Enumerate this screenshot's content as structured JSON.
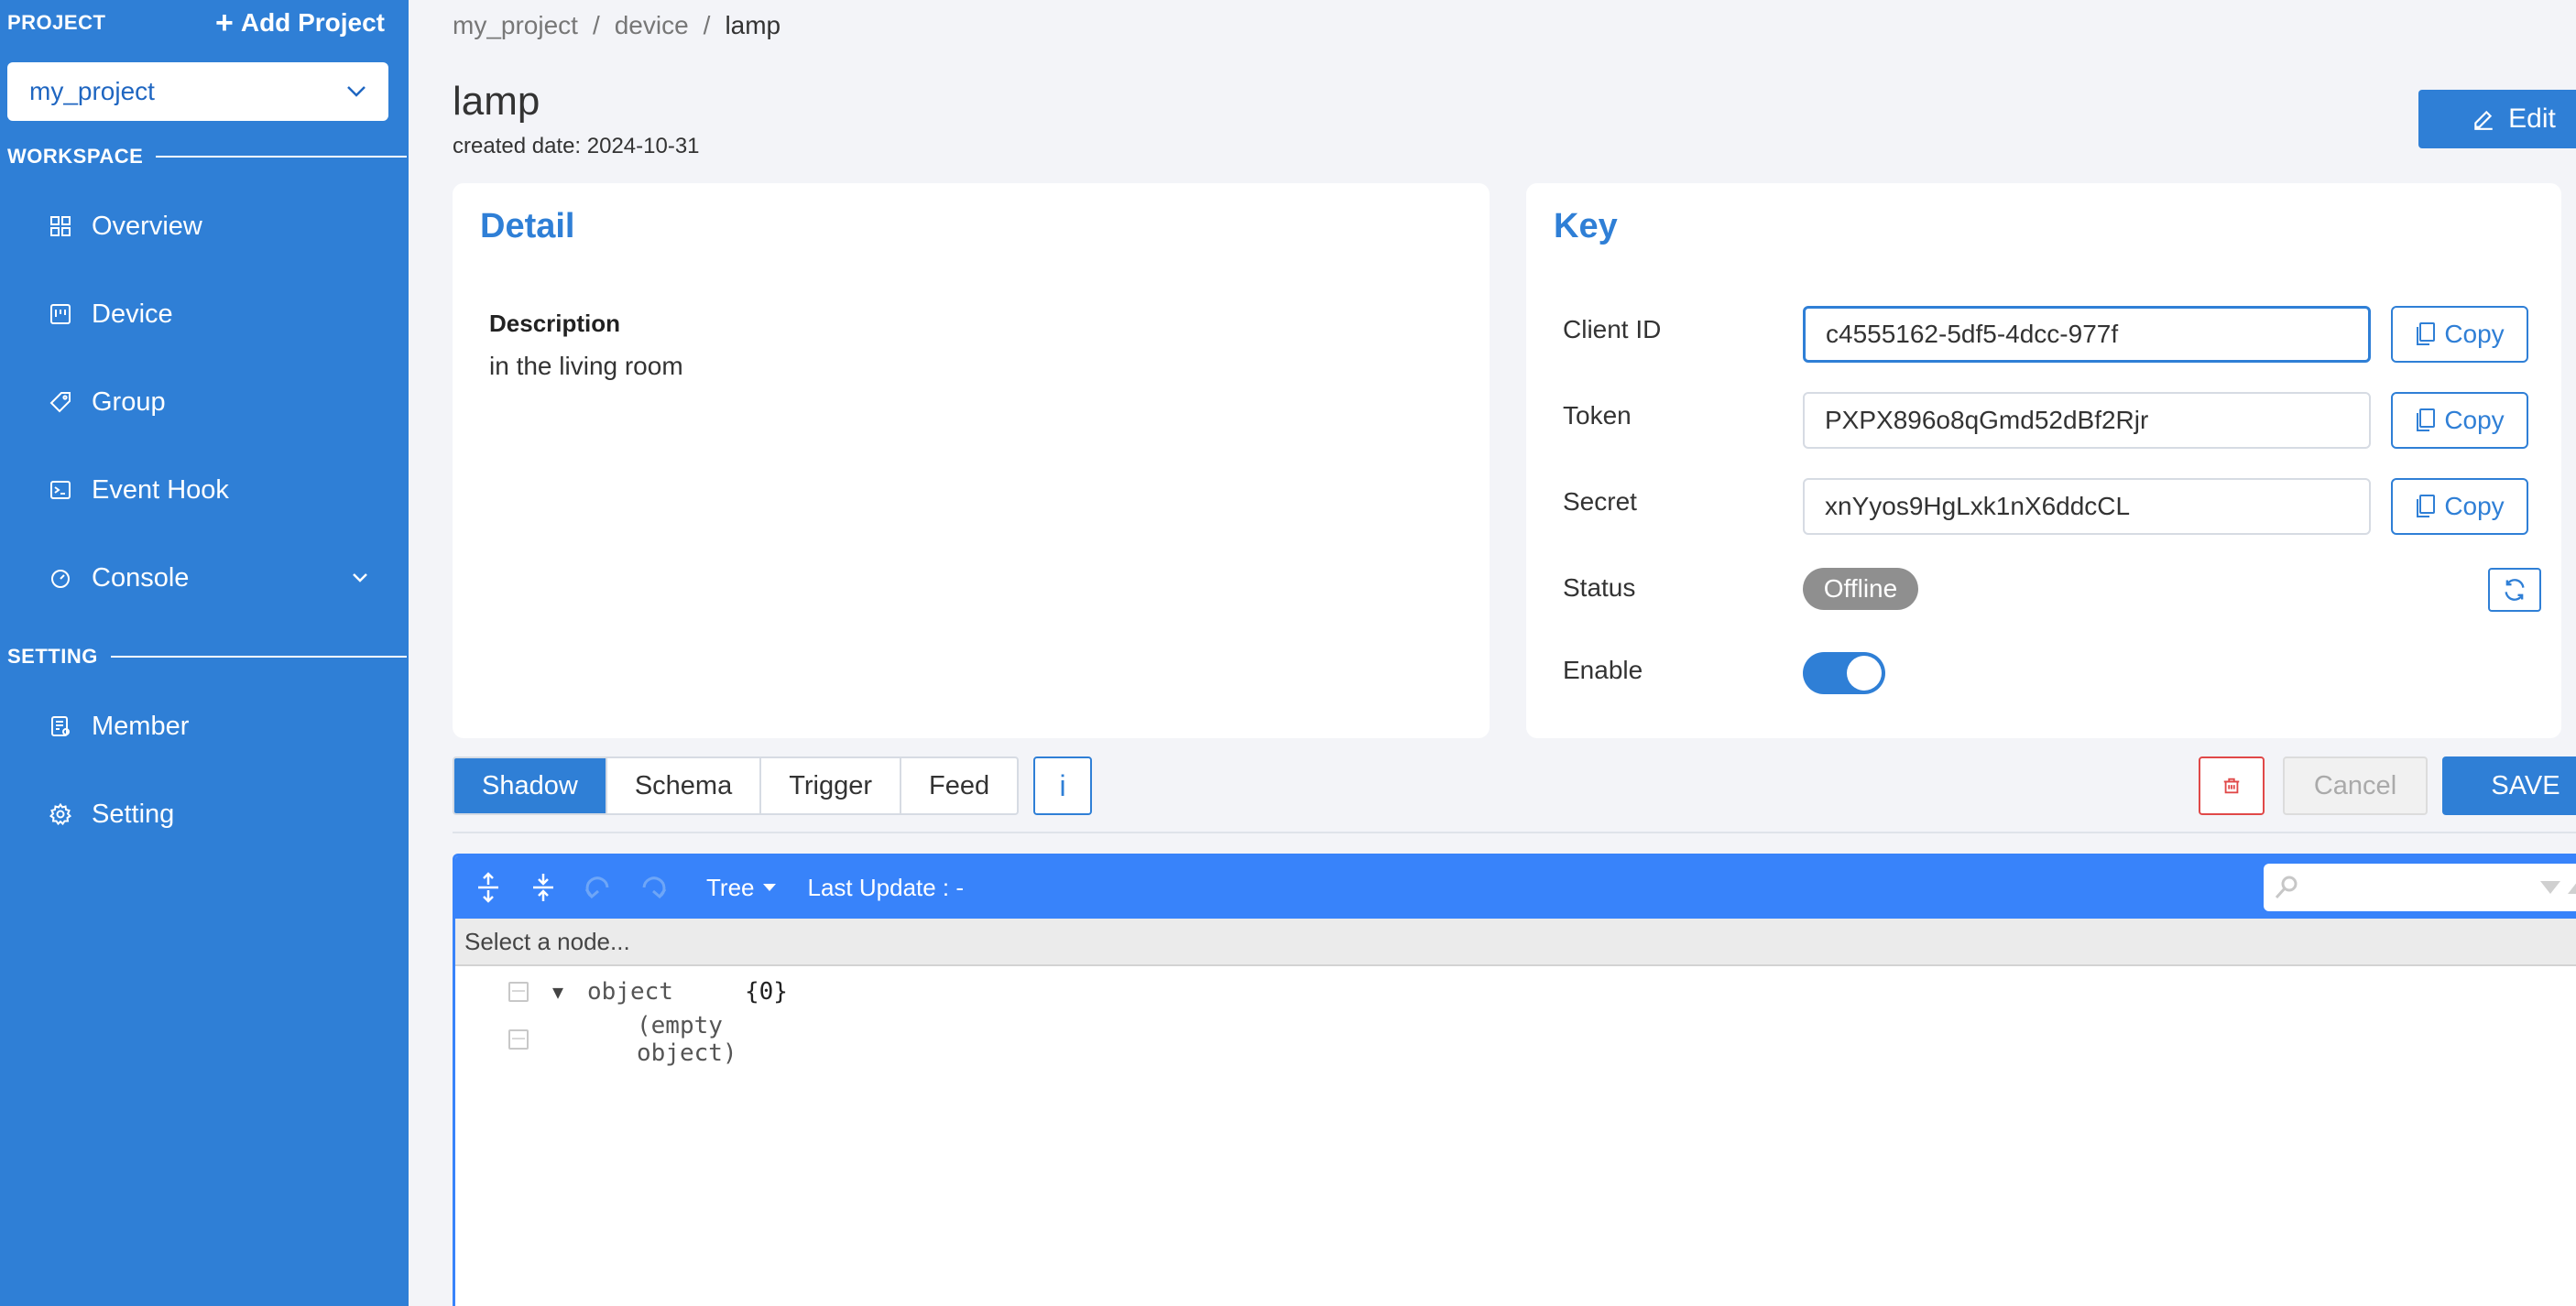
{
  "sidebar": {
    "project_label": "PROJECT",
    "add_project": "Add Project",
    "project_select": "my_project",
    "workspace_label": "WORKSPACE",
    "setting_label": "SETTING",
    "items": [
      {
        "label": "Overview",
        "icon": "grid-icon"
      },
      {
        "label": "Device",
        "icon": "device-icon"
      },
      {
        "label": "Group",
        "icon": "tag-icon"
      },
      {
        "label": "Event Hook",
        "icon": "terminal-icon"
      },
      {
        "label": "Console",
        "icon": "gauge-icon"
      },
      {
        "label": "Member",
        "icon": "member-icon"
      },
      {
        "label": "Setting",
        "icon": "gear-icon"
      }
    ]
  },
  "breadcrumb": [
    "my_project",
    "device",
    "lamp"
  ],
  "breadcrumb_sep": "/",
  "page": {
    "title": "lamp",
    "created": "created date: 2024-10-31",
    "edit_label": "Edit"
  },
  "detail": {
    "title": "Detail",
    "description_label": "Description",
    "description_value": "in the living room"
  },
  "key": {
    "title": "Key",
    "client_id_label": "Client ID",
    "client_id": "c4555162-5df5-4dcc-977f",
    "token_label": "Token",
    "token": "PXPX896o8qGmd52dBf2Rjr",
    "secret_label": "Secret",
    "secret": "xnYyos9HgLxk1nX6ddcCL",
    "copy_label": "Copy",
    "status_label": "Status",
    "status": "Offline",
    "enable_label": "Enable",
    "enabled": true
  },
  "tabs": [
    "Shadow",
    "Schema",
    "Trigger",
    "Feed"
  ],
  "info_label": "i",
  "actions": {
    "cancel": "Cancel",
    "save": "SAVE"
  },
  "editor": {
    "mode": "Tree",
    "last_update": "Last Update : -",
    "path_placeholder": "Select a node...",
    "root_type": "object",
    "root_count": "{0}",
    "empty": "(empty object)"
  },
  "colors": {
    "primary": "#2f7fd6",
    "editor_blue": "#3883fa",
    "danger": "#e04848",
    "offline": "#8f8f8f"
  }
}
